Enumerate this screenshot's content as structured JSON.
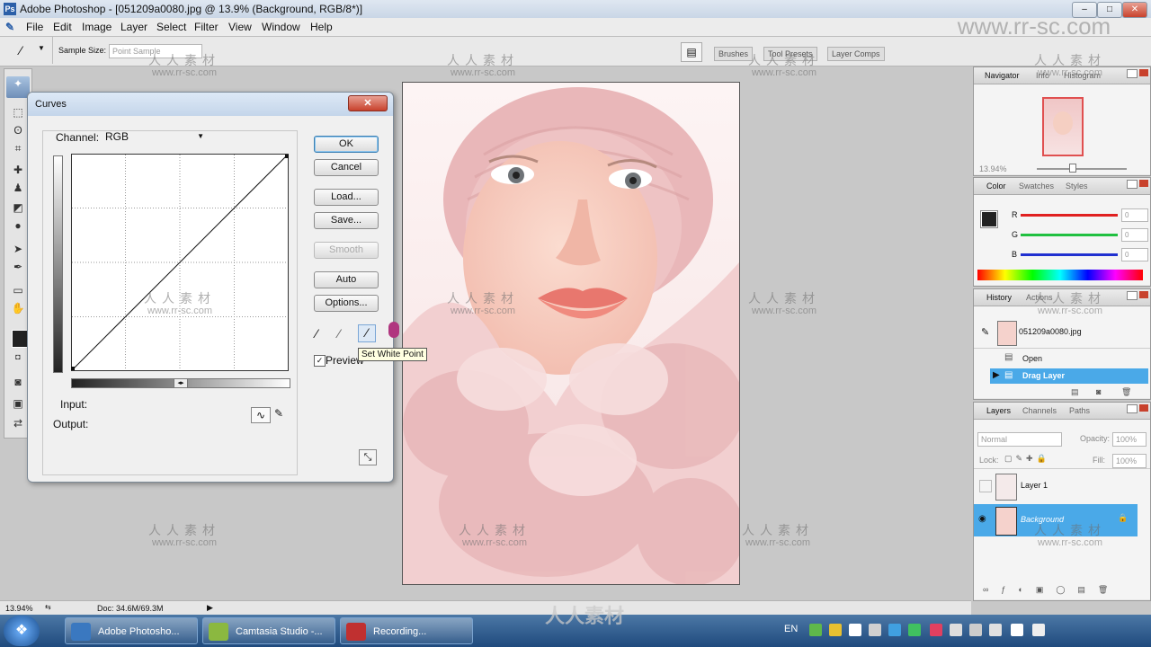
{
  "window": {
    "title": "Adobe Photoshop - [051209a0080.jpg @ 13.9% (Background, RGB/8*)]"
  },
  "menu": [
    "File",
    "Edit",
    "Image",
    "Layer",
    "Select",
    "Filter",
    "View",
    "Window",
    "Help"
  ],
  "options_bar": {
    "sample_size_label": "Sample Size:",
    "sample_size_value": "Point Sample"
  },
  "well_tabs": [
    "Brushes",
    "Tool Presets",
    "Layer Comps"
  ],
  "curves": {
    "title": "Curves",
    "channel_label": "Channel:",
    "channel_value": "RGB",
    "buttons": {
      "ok": "OK",
      "cancel": "Cancel",
      "load": "Load...",
      "save": "Save...",
      "smooth": "Smooth",
      "auto": "Auto",
      "options": "Options..."
    },
    "preview_label": "Preview",
    "preview_checked": true,
    "input_label": "Input:",
    "output_label": "Output:",
    "tooltip": "Set White Point"
  },
  "navigator": {
    "tabs": [
      "Navigator",
      "Info",
      "Histogram"
    ],
    "zoom": "13.94%"
  },
  "color": {
    "tabs": [
      "Color",
      "Swatches",
      "Styles"
    ],
    "channels": [
      {
        "label": "R",
        "value": "0",
        "color": "#e02020"
      },
      {
        "label": "G",
        "value": "0",
        "color": "#20c040"
      },
      {
        "label": "B",
        "value": "0",
        "color": "#2030d0"
      }
    ]
  },
  "history": {
    "tabs": [
      "History",
      "Actions"
    ],
    "snapshot": "051209a0080.jpg",
    "items": [
      "Open",
      "Drag Layer"
    ]
  },
  "layers": {
    "tabs": [
      "Layers",
      "Channels",
      "Paths"
    ],
    "blend_mode": "Normal",
    "opacity_label": "Opacity:",
    "opacity": "100%",
    "fill_label": "Fill:",
    "fill": "100%",
    "lock_label": "Lock:",
    "items": [
      "Layer 1",
      "Background"
    ]
  },
  "status": {
    "zoom": "13.94%",
    "doc": "Doc: 34.6M/69.3M"
  },
  "taskbar": {
    "buttons": [
      "Adobe Photosho...",
      "Camtasia Studio -...",
      "Recording..."
    ],
    "lang": "EN"
  },
  "watermark": {
    "cn": "人人素材",
    "url": "www.rr-sc.com",
    "corner_url": "www.rr-sc.com"
  }
}
